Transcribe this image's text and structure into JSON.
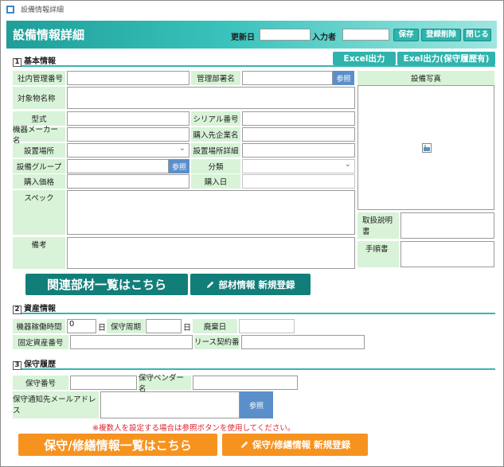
{
  "window": {
    "title": "設備情報詳細"
  },
  "header": {
    "title": "設備情報詳細",
    "updated_label": "更新日",
    "updated_value": "",
    "inputter_label": "入力者",
    "inputter_value": "",
    "save_label": "保存",
    "delete_label": "登録削除",
    "close_label": "閉じる"
  },
  "basic": {
    "section_num": "1",
    "section_title": "基本情報",
    "excel_label": "Excel出力",
    "excel_history_label": "Exel出力(保守履歴有)",
    "fields": {
      "internal_no": {
        "label": "社内管理番号",
        "value": ""
      },
      "mgmt_dept": {
        "label": "管理部署名",
        "value": ""
      },
      "target_name": {
        "label": "対象物名称",
        "value": ""
      },
      "model": {
        "label": "型式",
        "value": ""
      },
      "serial": {
        "label": "シリアル番号",
        "value": ""
      },
      "maker": {
        "label": "機器メーカー名",
        "value": ""
      },
      "vendor": {
        "label": "購入先企業名",
        "value": ""
      },
      "location": {
        "label": "設置場所",
        "value": ""
      },
      "location_detail": {
        "label": "設置場所詳細",
        "value": ""
      },
      "group": {
        "label": "設備グループ",
        "value": ""
      },
      "category": {
        "label": "分類",
        "value": ""
      },
      "price": {
        "label": "購入価格",
        "value": ""
      },
      "purchase_date": {
        "label": "購入日",
        "value": ""
      },
      "spec": {
        "label": "スペック",
        "value": ""
      },
      "remarks": {
        "label": "備考",
        "value": ""
      }
    },
    "ref_label": "参照",
    "photo_label": "設備写真",
    "manual_label": "取扱説明書",
    "procedure_label": "手順書",
    "related_parts_label": "関連部材一覧はこちら",
    "new_part_label": "部材情報 新規登録"
  },
  "asset": {
    "section_num": "2",
    "section_title": "資産情報",
    "operating_time": {
      "label": "機器稼働時間",
      "value": "0",
      "unit": "日"
    },
    "maintenance_period": {
      "label": "保守周期",
      "value": "",
      "unit": "日"
    },
    "disposal_date": {
      "label": "廃棄日",
      "value": ""
    },
    "fixed_asset_no": {
      "label": "固定資産番号",
      "value": ""
    },
    "lease_no": {
      "label": "リース契約番号",
      "value": ""
    }
  },
  "maintenance": {
    "section_num": "3",
    "section_title": "保守履歴",
    "maint_no": {
      "label": "保守番号",
      "value": ""
    },
    "vendor_name": {
      "label": "保守ベンダー名",
      "value": ""
    },
    "notify_email": {
      "label": "保守通知先メールアドレス",
      "value": ""
    },
    "ref_label": "参照",
    "note": "※複数人を設定する場合は参照ボタンを使用してください。",
    "list_label": "保守/修繕情報一覧はこちら",
    "new_label": "保守/修繕情報 新規登録"
  },
  "colors": {
    "header_teal": "#2fb4ad",
    "label_green": "#d8f3d8",
    "ref_blue": "#5b8fc9",
    "dark_teal": "#127e7a",
    "orange": "#f6931f",
    "note_red": "#e0212b"
  }
}
